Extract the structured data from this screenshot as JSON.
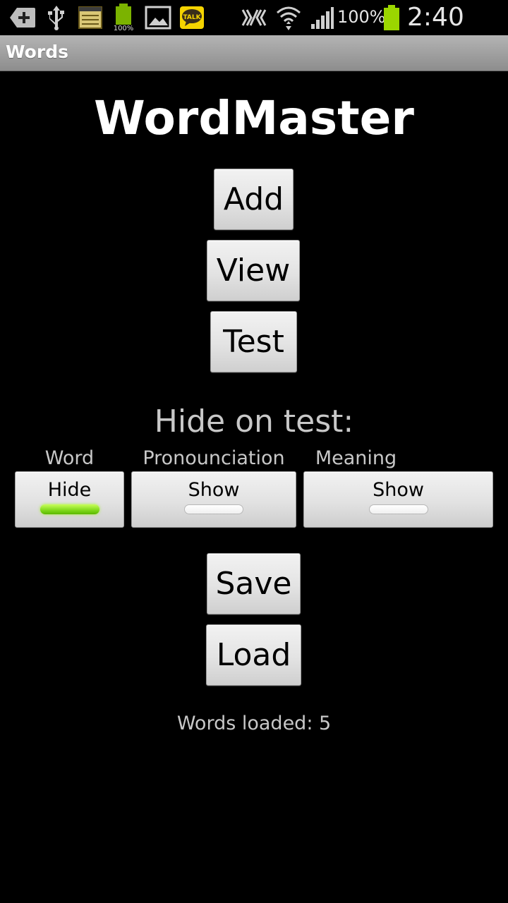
{
  "status_bar": {
    "battery_label": "100%",
    "notification_battery_text": "100%",
    "talk_icon_text": "TALK",
    "time": "2:40 AM",
    "accent_battery_color": "#9bd600"
  },
  "title_bar": {
    "title": "Words"
  },
  "app": {
    "title": "WordMaster"
  },
  "buttons": {
    "add": "Add",
    "view": "View",
    "test": "Test",
    "save": "Save",
    "load": "Load"
  },
  "hide_on_test": {
    "label": "Hide on test:",
    "toggles": [
      {
        "label": "Word",
        "state_text": "Hide",
        "on": true
      },
      {
        "label": "Pronounciation",
        "state_text": "Show",
        "on": false
      },
      {
        "label": "Meaning",
        "state_text": "Show",
        "on": false
      }
    ]
  },
  "status": {
    "words_loaded": "Words loaded: 5"
  }
}
